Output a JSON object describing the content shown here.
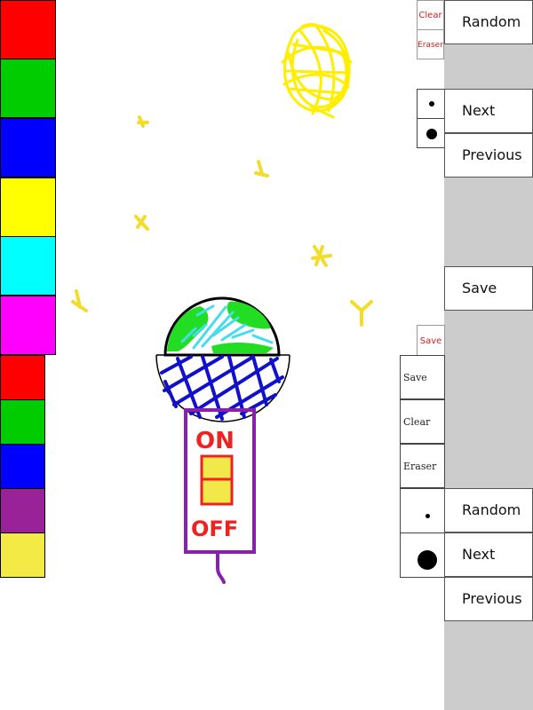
{
  "palette_top": {
    "colors": [
      "#ff0000",
      "#00cc00",
      "#0000ff",
      "#ffff00",
      "#00ffff",
      "#ff00ff"
    ]
  },
  "palette_bottom": {
    "colors": [
      "#ff0000",
      "#00cc00",
      "#0000ff",
      "#992299",
      "#f4ea46"
    ]
  },
  "panel_a": {
    "clear_label": "Clear",
    "eraser_label": "Eraser",
    "random_label": "Random",
    "next_label": "Next",
    "previous_label": "Previous",
    "save_label": "Save",
    "brush_small_icon": "small-dot-icon",
    "brush_large_icon": "large-dot-icon"
  },
  "panel_b": {
    "save_small_label": "Save",
    "save_label": "Save",
    "clear_label": "Clear",
    "eraser_label": "Eraser",
    "random_label": "Random",
    "next_label": "Next",
    "previous_label": "Previous",
    "brush_small_icon": "small-dot-icon",
    "brush_large_icon": "large-dot-icon"
  },
  "drawing": {
    "switch_on_text": "ON",
    "switch_off_text": "OFF",
    "colors": {
      "sun": "#ffee00",
      "star": "#f2dd2a",
      "globe_land": "#22dd22",
      "globe_water": "#44ddee",
      "net": "#1111cc",
      "body": "#8822aa",
      "switch_text": "#ee2222",
      "switch_fill": "#f2e84a"
    }
  }
}
